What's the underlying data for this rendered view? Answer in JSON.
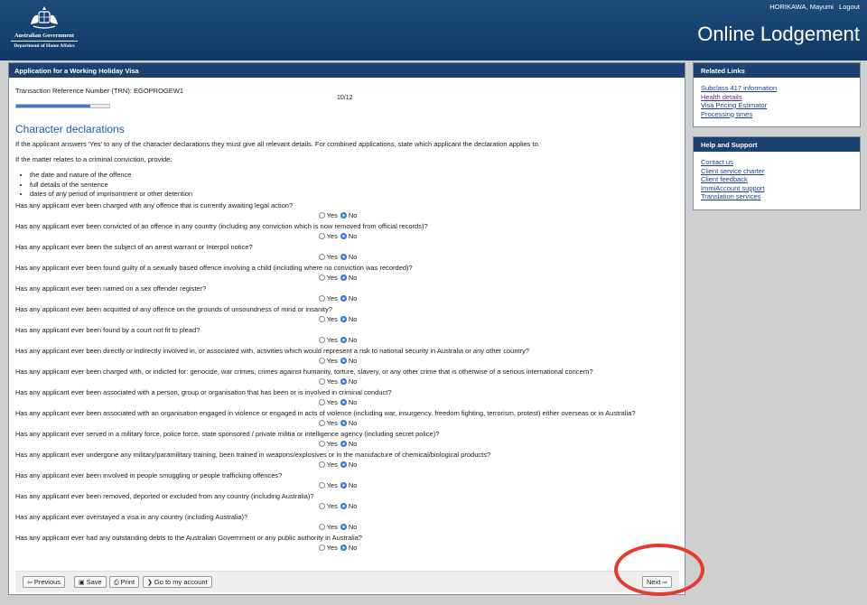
{
  "header": {
    "gov_name": "Australian Government",
    "department": "Department of Home Affairs",
    "user_name": "HORIKAWA, Mayumi",
    "logout": "Logout",
    "title": "Online Lodgement"
  },
  "main": {
    "heading": "Application for a Working Holiday Visa",
    "trn": "Transaction Reference Number (TRN): EGOPROGEW1",
    "page_indicator": "10/12",
    "progress": 0.8,
    "section_title": "Character declarations",
    "intro": "If the applicant answers 'Yes' to any of the character declarations they must give all relevant details. For combined applications, state which applicant the declaration applies to.",
    "conviction_intro": "If the matter relates to a criminal conviction, provide:",
    "bullets": [
      "the date and nature of the offence",
      "full details of the sentence",
      "dates of any period of imprisonment or other detention"
    ],
    "yes_label": "Yes",
    "no_label": "No",
    "questions": [
      {
        "text": "Has any applicant ever been charged with any offence that is currently awaiting legal action?",
        "answer": "No"
      },
      {
        "text": "Has any applicant ever been convicted of an offence in any country (including any conviction which is now removed from official records)?",
        "answer": "No"
      },
      {
        "text": "Has any applicant ever been the subject of an arrest warrant or Interpol notice?",
        "answer": "No"
      },
      {
        "text": "Has any applicant ever been found guilty of a sexually based offence involving a child (including where no conviction was recorded)?",
        "answer": "No"
      },
      {
        "text": "Has any applicant ever been named on a sex offender register?",
        "answer": "No"
      },
      {
        "text": "Has any applicant ever been acquitted of any offence on the grounds of unsoundness of mind or insanity?",
        "answer": "No"
      },
      {
        "text": "Has any applicant ever been found by a court not fit to plead?",
        "answer": "No"
      },
      {
        "text": "Has any applicant ever been directly or indirectly involved in, or associated with, activities which would represent a risk to national security in Australia or any other country?",
        "answer": "No"
      },
      {
        "text": "Has any applicant ever been charged with, or indicted for: genocide, war crimes, crimes against humanity, torture, slavery, or any other crime that is otherwise of a serious international concern?",
        "answer": "No"
      },
      {
        "text": "Has any applicant ever been associated with a person, group or organisation that has been or is involved in criminal conduct?",
        "answer": "No"
      },
      {
        "text": "Has any applicant ever been associated with an organisation engaged in violence or engaged in acts of violence (including war, insurgency, freedom fighting, terrorism, protest) either overseas or in Australia?",
        "answer": "No"
      },
      {
        "text": "Has any applicant ever served in a military force, police force, state sponsored / private militia or intelligence agency (including secret police)?",
        "answer": "No"
      },
      {
        "text": "Has any applicant ever undergone any military/paramilitary training, been trained in weapons/explosives or in the manufacture of chemical/biological products?",
        "answer": "No"
      },
      {
        "text": "Has any applicant ever been involved in people smuggling or people trafficking offences?",
        "answer": "No"
      },
      {
        "text": "Has any applicant ever been removed, deported or excluded from any country (including Australia)?",
        "answer": "No"
      },
      {
        "text": "Has any applicant ever overstayed a visa in any country (including Australia)?",
        "answer": "No"
      },
      {
        "text": "Has any applicant ever had any outstanding debts to the Australian Government or any public authority in Australia?",
        "answer": "No"
      }
    ],
    "buttons": {
      "previous": "Previous",
      "save": "Save",
      "print": "Print",
      "account": "Go to my account",
      "next": "Next"
    }
  },
  "related_links": {
    "heading": "Related Links",
    "items": [
      "Subclass 417 information",
      "Health details",
      "Visa Pricing Estimator",
      "Processing times"
    ]
  },
  "help": {
    "heading": "Help and Support",
    "items": [
      "Contact us",
      "Client service charter",
      "Client feedback",
      "ImmiAccount support",
      "Translation services"
    ]
  },
  "colors": {
    "header_bg": "#1d4c7a",
    "panel_head": "#1d4170",
    "section_title": "#1d5aa8",
    "annotation": "#e43b31"
  }
}
